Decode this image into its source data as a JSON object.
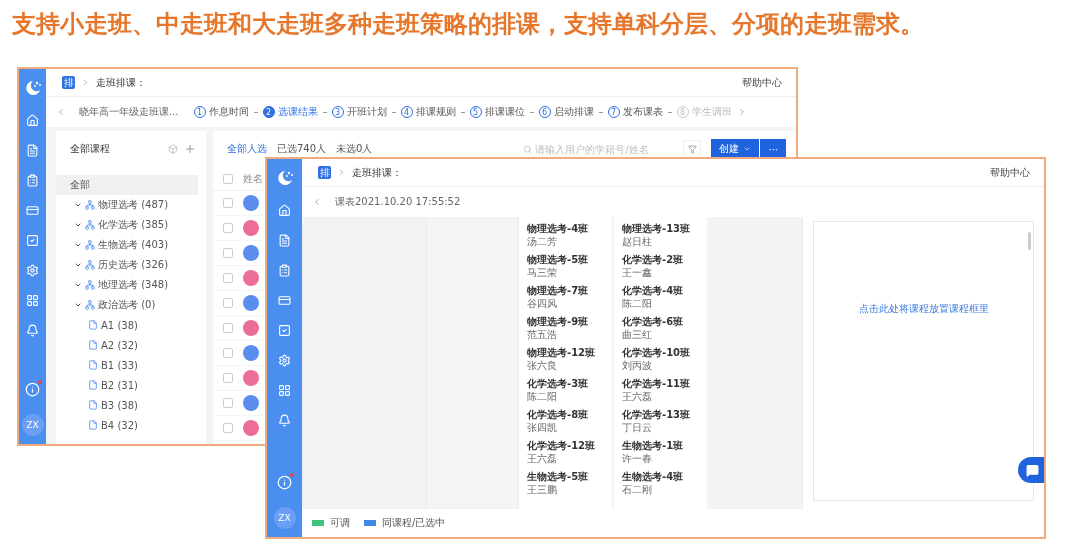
{
  "headline": "支持小走班、中走班和大走班多种走班策略的排课，支持单科分层、分项的走班需求。",
  "back_window": {
    "avatar": "ZX",
    "header": {
      "badge": "排",
      "title": "走班排课：",
      "help": "帮助中心"
    },
    "plan_select": "晓年高一年级走班课...",
    "steps": [
      {
        "number": "1",
        "label": "作息时间",
        "selected": false,
        "disabled": false
      },
      {
        "number": "2",
        "label": "选课结果",
        "selected": true,
        "disabled": false
      },
      {
        "number": "3",
        "label": "开班计划",
        "selected": false,
        "disabled": false
      },
      {
        "number": "4",
        "label": "排课规则",
        "selected": false,
        "disabled": false
      },
      {
        "number": "5",
        "label": "排课课位",
        "selected": false,
        "disabled": false
      },
      {
        "number": "6",
        "label": "启动排课",
        "selected": false,
        "disabled": false
      },
      {
        "number": "7",
        "label": "发布课表",
        "selected": false,
        "disabled": false
      },
      {
        "number": "8",
        "label": "学生调班",
        "selected": false,
        "disabled": true
      }
    ],
    "course_panel": {
      "title": "全部课程",
      "tree": [
        {
          "label": "全部",
          "selected": true,
          "children": [
            {
              "label": "物理选考 (487)",
              "kind": "group",
              "expanded": true,
              "selected": false
            },
            {
              "label": "化学选考 (385)",
              "kind": "group",
              "expanded": true,
              "selected": false
            },
            {
              "label": "生物选考 (403)",
              "kind": "group",
              "expanded": true,
              "selected": false
            },
            {
              "label": "历史选考 (326)",
              "kind": "group",
              "expanded": true,
              "selected": false
            },
            {
              "label": "地理选考 (348)",
              "kind": "group",
              "expanded": true,
              "selected": false
            },
            {
              "label": "政治选考 (0)",
              "kind": "group",
              "expanded": true,
              "selected": false,
              "children": [
                {
                  "label": "A1 (38)",
                  "kind": "item",
                  "selected": false
                },
                {
                  "label": "A2 (32)",
                  "kind": "item",
                  "selected": false
                },
                {
                  "label": "B1 (33)",
                  "kind": "item",
                  "selected": false
                },
                {
                  "label": "B2 (31)",
                  "kind": "item",
                  "selected": false
                },
                {
                  "label": "B3 (38)",
                  "kind": "item",
                  "selected": false
                },
                {
                  "label": "B4 (32)",
                  "kind": "item",
                  "selected": false
                }
              ]
            }
          ]
        }
      ]
    },
    "tabs": [
      {
        "label": "全部人选",
        "selected": true
      },
      {
        "label": "已选740人",
        "selected": false
      },
      {
        "label": "未选0人",
        "selected": false
      }
    ],
    "search": {
      "placeholder": "请输入用户的学籍号/姓名"
    },
    "create_button": "创建",
    "more_button": "···",
    "table": {
      "columns": [
        "姓名"
      ],
      "header_checked": false,
      "rows": [
        {
          "checked": false,
          "color": "#5b8def"
        },
        {
          "checked": false,
          "color": "#ec6d97"
        },
        {
          "checked": false,
          "color": "#5b8def"
        },
        {
          "checked": false,
          "color": "#ec6d97"
        },
        {
          "checked": false,
          "color": "#5b8def"
        },
        {
          "checked": false,
          "color": "#ec6d97"
        },
        {
          "checked": false,
          "color": "#5b8def"
        },
        {
          "checked": false,
          "color": "#ec6d97"
        },
        {
          "checked": false,
          "color": "#5b8def"
        },
        {
          "checked": false,
          "color": "#ec6d97"
        }
      ]
    }
  },
  "front_window": {
    "avatar": "ZX",
    "header": {
      "badge": "排",
      "title": "走班排课：",
      "help": "帮助中心"
    },
    "timetable": "课表2021.10.20 17:55:52",
    "class_columns": [
      [
        {
          "name": "物理选考-4班",
          "teacher": "汤二芳"
        },
        {
          "name": "物理选考-5班",
          "teacher": "马三荣"
        },
        {
          "name": "物理选考-7班",
          "teacher": "谷四风"
        },
        {
          "name": "物理选考-9班",
          "teacher": "范五浩"
        },
        {
          "name": "物理选考-12班",
          "teacher": "张六良"
        },
        {
          "name": "化学选考-3班",
          "teacher": "陈二阳"
        },
        {
          "name": "化学选考-8班",
          "teacher": "张四凯"
        },
        {
          "name": "化学选考-12班",
          "teacher": "王六磊"
        },
        {
          "name": "生物选考-5班",
          "teacher": "王三鹏"
        }
      ],
      [
        {
          "name": "物理选考-13班",
          "teacher": "赵日柱"
        },
        {
          "name": "化学选考-2班",
          "teacher": "王一鑫"
        },
        {
          "name": "化学选考-4班",
          "teacher": "陈二阳"
        },
        {
          "name": "化学选考-6班",
          "teacher": "曲三红"
        },
        {
          "name": "化学选考-10班",
          "teacher": "刘丙波"
        },
        {
          "name": "化学选考-11班",
          "teacher": "王六磊"
        },
        {
          "name": "化学选考-13班",
          "teacher": "丁日云"
        },
        {
          "name": "生物选考-1班",
          "teacher": "许一春"
        },
        {
          "name": "生物选考-4班",
          "teacher": "石二刚"
        }
      ]
    ],
    "drop_hint": "点击此处将课程放置课程框里",
    "legend": [
      {
        "label": "可调",
        "color": "#3cc47c"
      },
      {
        "label": "同课程/已选中",
        "color": "#3f8ae8"
      }
    ]
  }
}
